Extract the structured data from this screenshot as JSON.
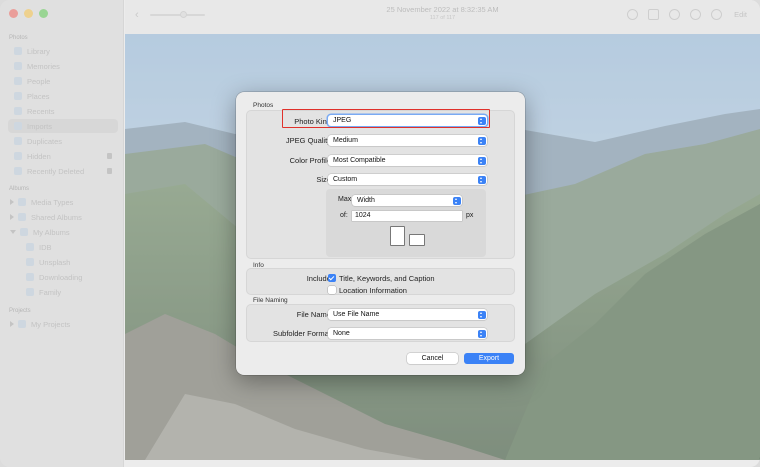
{
  "window": {
    "title": "25 November 2022 at 8:32:35 AM",
    "subtitle": "117 of 117",
    "edit_label": "Edit"
  },
  "sidebar": {
    "sections": {
      "photos": "Photos",
      "albums": "Albums",
      "projects": "Projects"
    },
    "photos_items": [
      "Library",
      "Memories",
      "People",
      "Places",
      "Recents",
      "Imports",
      "Duplicates",
      "Hidden",
      "Recently Deleted"
    ],
    "album_items": [
      "Media Types",
      "Shared Albums",
      "My Albums",
      "IDB",
      "Unsplash",
      "Downloading",
      "Family"
    ],
    "project_items": [
      "My Projects"
    ]
  },
  "dialog": {
    "photos_section": "Photos",
    "info_section": "Info",
    "file_naming_section": "File Naming",
    "photo_kind": {
      "label": "Photo Kind:",
      "value": "JPEG"
    },
    "jpeg_quality": {
      "label": "JPEG Quality:",
      "value": "Medium"
    },
    "color_profile": {
      "label": "Color Profile:",
      "value": "Most Compatible"
    },
    "size": {
      "label": "Size:",
      "value": "Custom"
    },
    "max": {
      "label": "Max",
      "value": "Width"
    },
    "of": {
      "label": "of:",
      "value": "1024",
      "unit": "px"
    },
    "include": {
      "label": "Include:",
      "title_keywords": {
        "label": "Title, Keywords, and Caption",
        "checked": true
      },
      "location": {
        "label": "Location Information",
        "checked": false
      }
    },
    "file_name": {
      "label": "File Name:",
      "value": "Use File Name"
    },
    "subfolder": {
      "label": "Subfolder Format:",
      "value": "None"
    },
    "cancel_label": "Cancel",
    "export_label": "Export"
  },
  "colors": {
    "accent": "#3b82f6",
    "highlight": "#e0312b"
  }
}
